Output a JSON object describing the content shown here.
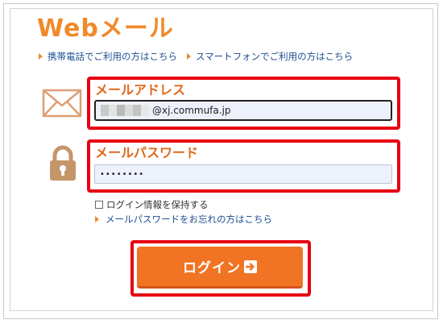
{
  "header": {
    "title": "Webメール"
  },
  "nav_links": [
    {
      "label": "携帯電話でご利用の方はこちら"
    },
    {
      "label": "スマートフォンでご利用の方はこちら"
    }
  ],
  "form": {
    "email_label": "メールアドレス",
    "email_value": "@xj.commufa.jp",
    "password_label": "メールパスワード",
    "password_value": "••••••••",
    "remember_label": "ログイン情報を保持する",
    "forgot_link": "メールパスワードをお忘れの方はこちら",
    "login_button": "ログイン"
  },
  "icons": {
    "email": "envelope-icon",
    "password": "padlock-icon",
    "login": "arrow-right-icon"
  },
  "colors": {
    "accent": "#f08a2a",
    "button": "#f07423",
    "highlight": "#e60012",
    "link": "#1d4f8f"
  }
}
